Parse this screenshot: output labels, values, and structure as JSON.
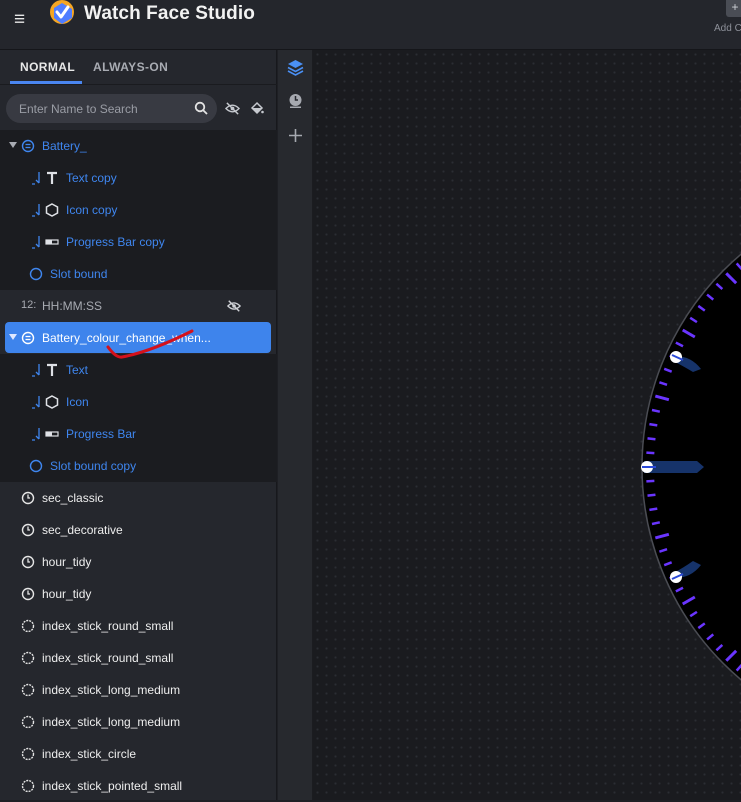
{
  "app": {
    "title": "Watch Face Studio",
    "add_button_icon": "+",
    "add_label": "Add C",
    "menu_icon": "≡"
  },
  "tabs": [
    {
      "label": "NORMAL",
      "active": true
    },
    {
      "label": "ALWAYS-ON",
      "active": false
    }
  ],
  "search": {
    "placeholder": "Enter Name to Search"
  },
  "layers": [
    {
      "label": "Battery_",
      "type": "group",
      "expanded": true
    },
    {
      "label": "Text copy",
      "type": "text"
    },
    {
      "label": "Icon copy",
      "type": "icon"
    },
    {
      "label": "Progress Bar copy",
      "type": "progress-bar"
    },
    {
      "label": "Slot bound",
      "type": "slot"
    },
    {
      "label": "HH:MM:SS",
      "prefix": "12:",
      "type": "time",
      "hidden": true
    },
    {
      "label": "Battery_colour_change_when...",
      "type": "group",
      "expanded": true,
      "selected": true
    },
    {
      "label": "Text",
      "type": "text"
    },
    {
      "label": "Icon",
      "type": "icon"
    },
    {
      "label": "Progress Bar",
      "type": "progress-bar"
    },
    {
      "label": "Slot bound copy",
      "type": "slot"
    },
    {
      "label": "sec_classic",
      "type": "hand"
    },
    {
      "label": "sec_decorative",
      "type": "hand"
    },
    {
      "label": "hour_tidy",
      "type": "hand"
    },
    {
      "label": "hour_tidy",
      "type": "hand"
    },
    {
      "label": "index_stick_round_small",
      "type": "index"
    },
    {
      "label": "index_stick_round_small",
      "type": "index"
    },
    {
      "label": "index_stick_long_medium",
      "type": "index"
    },
    {
      "label": "index_stick_long_medium",
      "type": "index"
    },
    {
      "label": "index_stick_circle",
      "type": "index"
    },
    {
      "label": "index_stick_pointed_small",
      "type": "index"
    }
  ],
  "colors": {
    "accent": "#3f86ef",
    "selection": "#3e84ec",
    "annotation": "#d4111b",
    "tick": "#6a35ff"
  }
}
